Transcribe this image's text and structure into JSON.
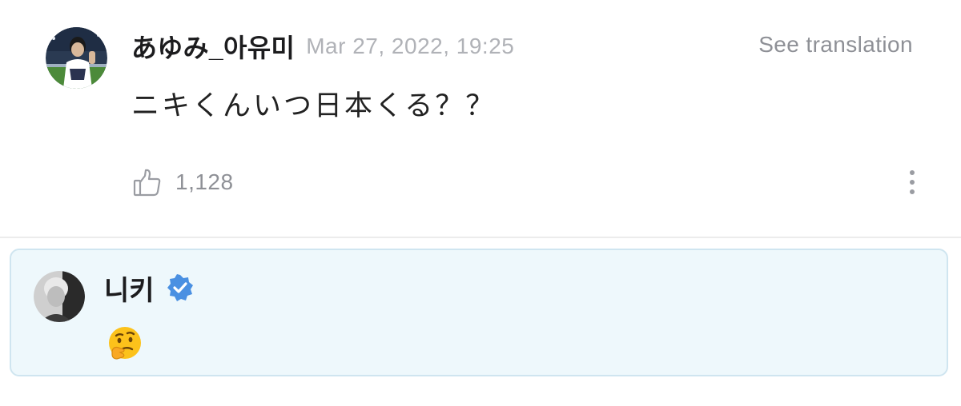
{
  "comment": {
    "author": "あゆみ_아유미",
    "timestamp": "Mar 27, 2022, 19:25",
    "translate_label": "See translation",
    "text": "ニキくんいつ日本くる？？",
    "like_count": "1,128"
  },
  "reply": {
    "author": "니키",
    "verified": true,
    "text": "🤔"
  },
  "colors": {
    "verified_badge": "#4a90e2",
    "reply_background": "#eef8fc",
    "reply_border": "#cfe5f0",
    "muted_text": "#8e9096"
  }
}
